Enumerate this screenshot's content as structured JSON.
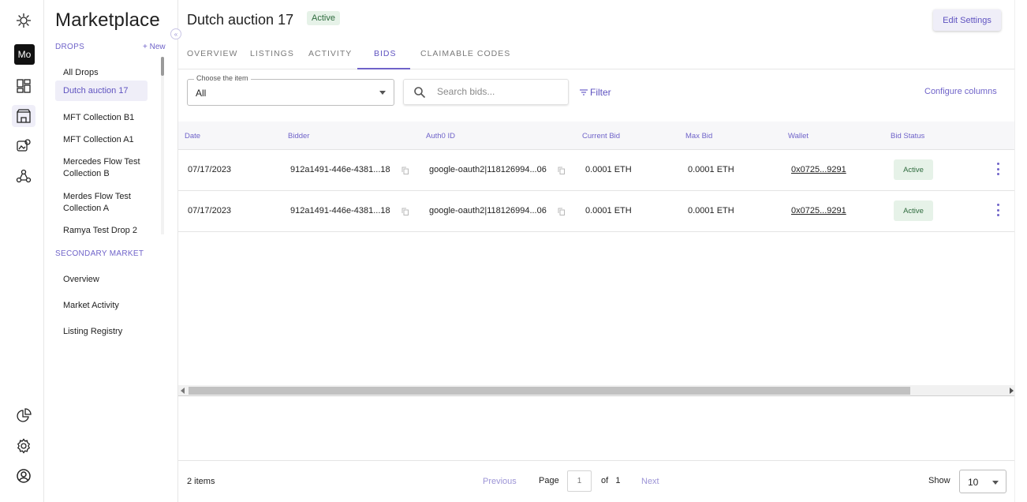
{
  "rail": {
    "workspace_badge": "Mo",
    "icons": [
      "logo-icon",
      "dashboard-icon",
      "marketplace-icon",
      "collections-icon",
      "network-icon",
      "analytics-icon",
      "settings-icon",
      "account-icon"
    ]
  },
  "sidebar": {
    "title": "Marketplace",
    "drops_label": "DROPS",
    "new_label": "+ New",
    "collapse_glyph": "«",
    "drops": [
      {
        "label": "All Drops",
        "selected": false
      },
      {
        "label": "Dutch auction 17",
        "selected": true
      },
      {
        "label": "MFT Collection B1",
        "selected": false
      },
      {
        "label": "MFT Collection A1",
        "selected": false
      },
      {
        "label": "Mercedes Flow Test Collection B",
        "selected": false
      },
      {
        "label": "Merdes Flow Test Collection A",
        "selected": false
      },
      {
        "label": "Ramya Test Drop 2",
        "selected": false
      }
    ],
    "secondary_label": "SECONDARY MARKET",
    "secondary": [
      {
        "label": "Overview"
      },
      {
        "label": "Market Activity"
      },
      {
        "label": "Listing Registry"
      }
    ]
  },
  "header": {
    "title": "Dutch auction 17",
    "status": "Active",
    "edit_label": "Edit Settings"
  },
  "tabs": [
    {
      "label": "OVERVIEW",
      "active": false
    },
    {
      "label": "LISTINGS",
      "active": false
    },
    {
      "label": "ACTIVITY",
      "active": false
    },
    {
      "label": "BIDS",
      "active": true
    },
    {
      "label": "CLAIMABLE CODES",
      "active": false
    }
  ],
  "filters": {
    "item_select_label": "Choose the item",
    "item_select_value": "All",
    "search_placeholder": "Search bids...",
    "filter_label": "Filter",
    "configure_label": "Configure columns"
  },
  "table": {
    "columns": [
      "Date",
      "Bidder",
      "Auth0 ID",
      "Current Bid",
      "Max Bid",
      "Wallet",
      "Bid Status"
    ],
    "rows": [
      {
        "date": "07/17/2023",
        "bidder": "912a1491-446e-4381...18",
        "auth0": "google-oauth2|118126994...06",
        "current_bid": "0.0001 ETH",
        "max_bid": "0.0001 ETH",
        "wallet": "0x0725...9291",
        "status": "Active"
      },
      {
        "date": "07/17/2023",
        "bidder": "912a1491-446e-4381...18",
        "auth0": "google-oauth2|118126994...06",
        "current_bid": "0.0001 ETH",
        "max_bid": "0.0001 ETH",
        "wallet": "0x0725...9291",
        "status": "Active"
      }
    ]
  },
  "footer": {
    "count": "2 items",
    "previous": "Previous",
    "page_label": "Page",
    "page_value": "1",
    "of_label": "of",
    "total_pages": "1",
    "next": "Next",
    "show_label": "Show",
    "show_value": "10"
  },
  "colors": {
    "accent": "#6f63c9",
    "accent_bg": "#efeef8",
    "status_bg": "#e6f2e8",
    "status_text": "#2f6b3e"
  }
}
